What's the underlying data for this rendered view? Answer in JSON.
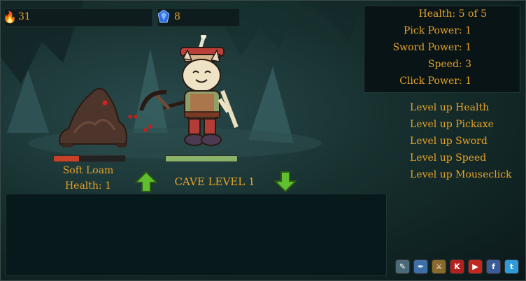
{
  "resources": {
    "ore_count": "31",
    "gem_count": "8",
    "ore_icon": "flame-ore-icon",
    "gem_icon": "blue-gem-icon"
  },
  "stats": {
    "health": "Health: 5 of 5",
    "pick_power": "Pick Power: 1",
    "sword_power": "Sword Power: 1",
    "speed": "Speed: 3",
    "click_power": "Click Power: 1"
  },
  "level_up": {
    "health": "Level up Health",
    "pickaxe": "Level up Pickaxe",
    "sword": "Level up Sword",
    "speed": "Level up Speed",
    "mouseclick": "Level up Mouseclick"
  },
  "block": {
    "name": "Soft Loam",
    "health": "Health: 1",
    "health_fraction": 0.35
  },
  "player": {
    "energy_fraction": 1.0
  },
  "cave": {
    "level_label": "CAVE LEVEL 1"
  },
  "social_icons": [
    {
      "name": "kongregate-icon",
      "glyph": "✎",
      "color": "#4a6a78"
    },
    {
      "name": "feather-icon",
      "glyph": "✒",
      "color": "#3f6fa8"
    },
    {
      "name": "game-icon",
      "glyph": "⚔",
      "color": "#8a6a2a"
    },
    {
      "name": "k-icon",
      "glyph": "K",
      "color": "#b3201d"
    },
    {
      "name": "youtube-icon",
      "glyph": "▶",
      "color": "#c1261f"
    },
    {
      "name": "facebook-icon",
      "glyph": "f",
      "color": "#3b5a98"
    },
    {
      "name": "twitter-icon",
      "glyph": "t",
      "color": "#2f9ad9"
    }
  ],
  "colors": {
    "text": "#e6a329",
    "arrow": "#5fbf2e",
    "block_health": "#c8422a",
    "player_energy": "#8ab36a"
  }
}
